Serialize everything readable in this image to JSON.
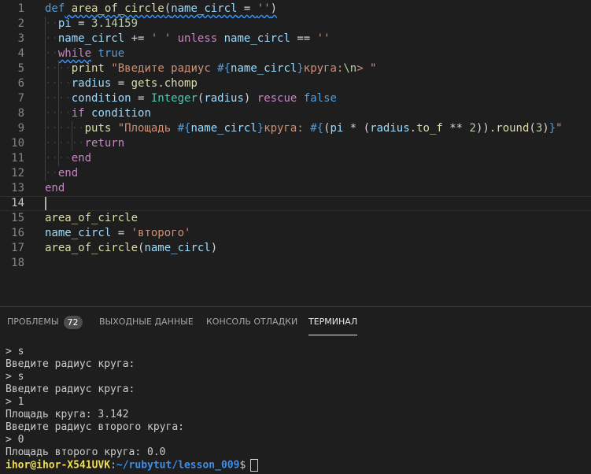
{
  "editor": {
    "lines": [
      {
        "n": "1",
        "tokens": [
          [
            "kw2",
            "def"
          ],
          [
            "op",
            " "
          ],
          [
            "fn",
            "area_of_circle"
          ],
          [
            "op",
            "("
          ],
          [
            "var",
            "name_circl"
          ],
          [
            "op",
            " = "
          ],
          [
            "str",
            "''"
          ],
          [
            "op",
            ")"
          ]
        ]
      },
      {
        "n": "2",
        "tokens": [
          [
            "var",
            "pi"
          ],
          [
            "op",
            " = "
          ],
          [
            "num",
            "3.14159"
          ]
        ]
      },
      {
        "n": "3",
        "tokens": [
          [
            "var",
            "name_circl"
          ],
          [
            "op",
            " += "
          ],
          [
            "str",
            "' '"
          ],
          [
            "op",
            " "
          ],
          [
            "kw",
            "unless"
          ],
          [
            "op",
            " "
          ],
          [
            "var",
            "name_circl"
          ],
          [
            "op",
            " == "
          ],
          [
            "str",
            "''"
          ]
        ]
      },
      {
        "n": "4",
        "tokens": [
          [
            "kw",
            "while"
          ],
          [
            "op",
            " "
          ],
          [
            "kw2",
            "true"
          ]
        ]
      },
      {
        "n": "5",
        "tokens": [
          [
            "fn",
            "print"
          ],
          [
            "op",
            " "
          ],
          [
            "str",
            "\"Введите радиус "
          ],
          [
            "interp",
            "#{"
          ],
          [
            "var",
            "name_circl"
          ],
          [
            "interp",
            "}"
          ],
          [
            "str",
            "круга:"
          ],
          [
            "num",
            "\\n"
          ],
          [
            "str",
            "> \""
          ]
        ]
      },
      {
        "n": "6",
        "tokens": [
          [
            "var",
            "radius"
          ],
          [
            "op",
            " = "
          ],
          [
            "fn",
            "gets"
          ],
          [
            "op",
            "."
          ],
          [
            "fn",
            "chomp"
          ]
        ]
      },
      {
        "n": "7",
        "tokens": [
          [
            "var",
            "condition"
          ],
          [
            "op",
            " = "
          ],
          [
            "cls",
            "Integer"
          ],
          [
            "op",
            "("
          ],
          [
            "var",
            "radius"
          ],
          [
            "op",
            ") "
          ],
          [
            "kw",
            "rescue"
          ],
          [
            "op",
            " "
          ],
          [
            "kw2",
            "false"
          ]
        ]
      },
      {
        "n": "8",
        "tokens": [
          [
            "kw",
            "if"
          ],
          [
            "op",
            " "
          ],
          [
            "var",
            "condition"
          ]
        ]
      },
      {
        "n": "9",
        "tokens": [
          [
            "fn",
            "puts"
          ],
          [
            "op",
            " "
          ],
          [
            "str",
            "\"Площадь "
          ],
          [
            "interp",
            "#{"
          ],
          [
            "var",
            "name_circl"
          ],
          [
            "interp",
            "}"
          ],
          [
            "str",
            "круга: "
          ],
          [
            "interp",
            "#{"
          ],
          [
            "op",
            "("
          ],
          [
            "var",
            "pi"
          ],
          [
            "op",
            " * ("
          ],
          [
            "var",
            "radius"
          ],
          [
            "op",
            "."
          ],
          [
            "fn",
            "to_f"
          ],
          [
            "op",
            " ** "
          ],
          [
            "num",
            "2"
          ],
          [
            "op",
            "))."
          ],
          [
            "fn",
            "round"
          ],
          [
            "op",
            "("
          ],
          [
            "num",
            "3"
          ],
          [
            "op",
            ")"
          ],
          [
            "interp",
            "}"
          ],
          [
            "str",
            "\""
          ]
        ]
      },
      {
        "n": "10",
        "tokens": [
          [
            "kw",
            "return"
          ]
        ]
      },
      {
        "n": "11",
        "tokens": [
          [
            "kw",
            "end"
          ]
        ]
      },
      {
        "n": "12",
        "tokens": [
          [
            "kw",
            "end"
          ]
        ]
      },
      {
        "n": "13",
        "tokens": [
          [
            "kw",
            "end"
          ]
        ]
      },
      {
        "n": "14",
        "tokens": []
      },
      {
        "n": "15",
        "tokens": [
          [
            "fn",
            "area_of_circle"
          ]
        ]
      },
      {
        "n": "16",
        "tokens": [
          [
            "var",
            "name_circl"
          ],
          [
            "op",
            " = "
          ],
          [
            "str",
            "'второго'"
          ]
        ]
      },
      {
        "n": "17",
        "tokens": [
          [
            "fn",
            "area_of_circle"
          ],
          [
            "op",
            "("
          ],
          [
            "var",
            "name_circl"
          ],
          [
            "op",
            ")"
          ]
        ]
      },
      {
        "n": "18",
        "tokens": []
      }
    ],
    "current_line": "14"
  },
  "panel": {
    "tabs": [
      {
        "label": "ПРОБЛЕМЫ",
        "badge": "72"
      },
      {
        "label": "ВЫХОДНЫЕ ДАННЫЕ"
      },
      {
        "label": "КОНСОЛЬ ОТЛАДКИ"
      },
      {
        "label": "ТЕРМИНАЛ"
      }
    ],
    "active_tab": "ТЕРМИНАЛ"
  },
  "terminal": {
    "lines": [
      "> s",
      "Введите радиус круга:",
      "> s",
      "Введите радиус круга:",
      "> 1",
      "Площадь круга: 3.142",
      "Введите радиус второго круга:",
      "> 0",
      "Площадь второго круга: 0.0"
    ],
    "prompt_user": "ihor@ihor-X541UVK",
    "prompt_sep": ":",
    "prompt_path": "~/rubytut/lesson_009",
    "prompt_symbol": "$"
  }
}
